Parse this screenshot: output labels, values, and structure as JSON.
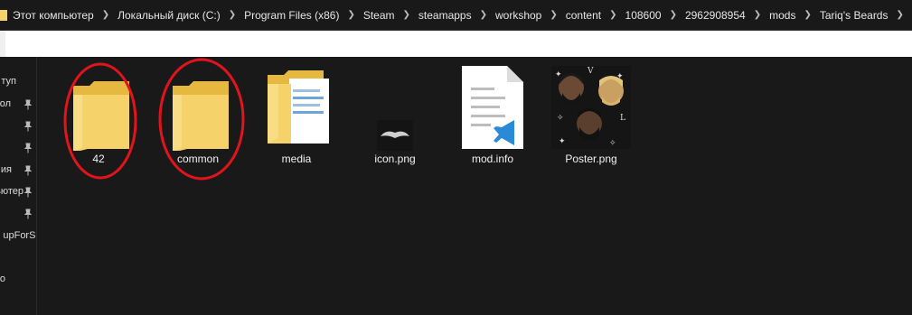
{
  "address_bar": {
    "crumbs": [
      "Этот компьютер",
      "Локальный диск (C:)",
      "Program Files (x86)",
      "Steam",
      "steamapps",
      "workshop",
      "content",
      "108600",
      "2962908954",
      "mods",
      "Tariq's Beards"
    ]
  },
  "nav": {
    "items": [
      {
        "label": "туп",
        "pinned": false
      },
      {
        "label": "ол",
        "pinned": true
      },
      {
        "label": "",
        "pinned": true
      },
      {
        "label": "",
        "pinned": true
      },
      {
        "label": "ия",
        "pinned": true
      },
      {
        "label": "ьютер",
        "pinned": true
      },
      {
        "label": "",
        "pinned": true
      },
      {
        "label": "upForSin",
        "pinned": false
      },
      {
        "label": "",
        "pinned": false
      },
      {
        "label": "о",
        "pinned": false
      }
    ]
  },
  "files": [
    {
      "name": "42",
      "type": "folder",
      "highlighted": true
    },
    {
      "name": "common",
      "type": "folder",
      "highlighted": true
    },
    {
      "name": "media",
      "type": "folder-with-docs",
      "highlighted": false
    },
    {
      "name": "icon.png",
      "type": "image",
      "highlighted": false
    },
    {
      "name": "mod.info",
      "type": "vscode-file",
      "highlighted": false
    },
    {
      "name": "Poster.png",
      "type": "image-poster",
      "highlighted": false
    }
  ],
  "colors": {
    "folder": "#f6d36a",
    "folder_dark": "#e7b83f",
    "highlight_ring": "#e0141c",
    "vscode_blue": "#2a8ad8"
  }
}
